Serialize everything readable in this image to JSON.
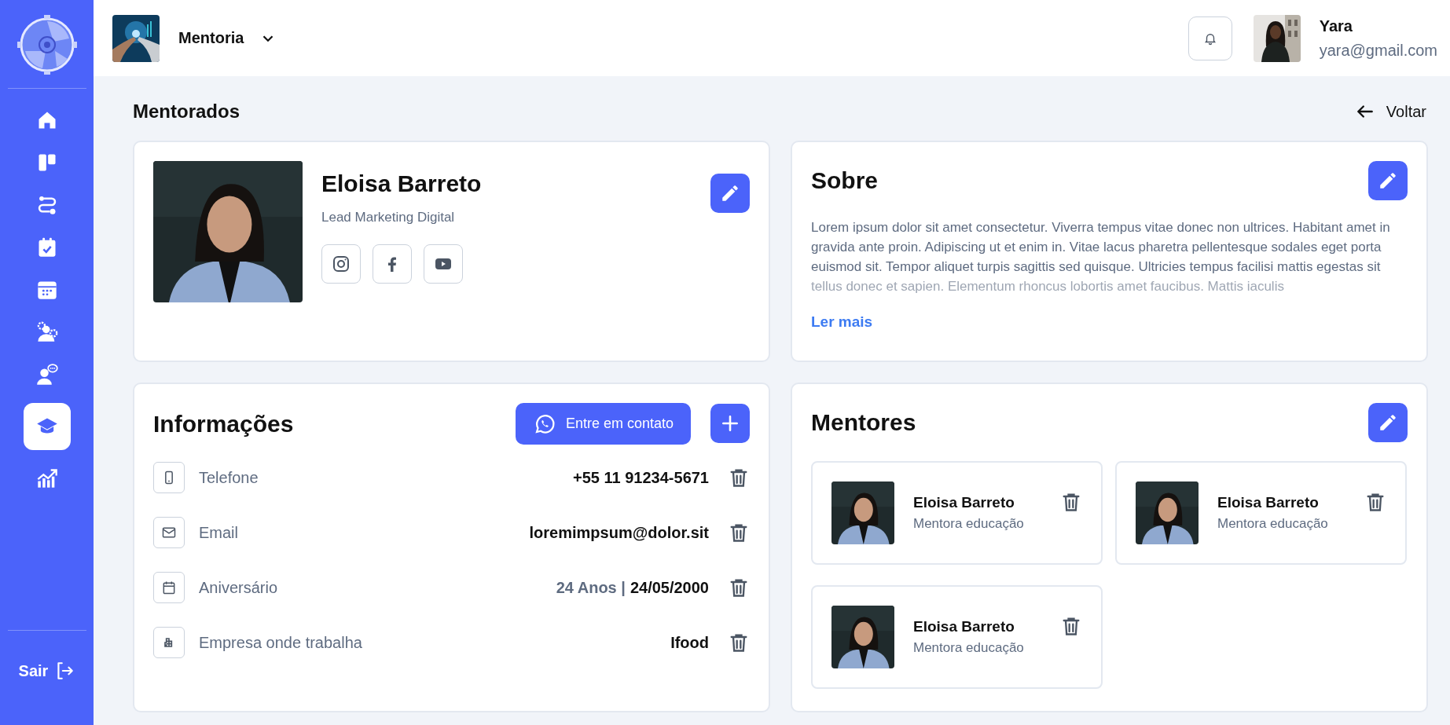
{
  "sidebar": {
    "items": [
      {
        "kind": "home",
        "selected": false
      },
      {
        "kind": "board",
        "selected": false
      },
      {
        "kind": "route",
        "selected": false
      },
      {
        "kind": "task",
        "selected": false
      },
      {
        "kind": "calendar",
        "selected": false
      },
      {
        "kind": "team",
        "selected": false
      },
      {
        "kind": "chat",
        "selected": false
      },
      {
        "kind": "course",
        "selected": true
      },
      {
        "kind": "chart",
        "selected": false
      }
    ],
    "logout": "Sair"
  },
  "header": {
    "program": "Mentoria",
    "user": {
      "name": "Yara",
      "email": "yara@gmail.com"
    }
  },
  "page": {
    "title": "Mentorados",
    "back": "Voltar"
  },
  "profile": {
    "name": "Eloisa Barreto",
    "role": "Lead Marketing Digital",
    "socials": [
      {
        "kind": "instagram"
      },
      {
        "kind": "facebook"
      },
      {
        "kind": "youtube"
      }
    ]
  },
  "about": {
    "title": "Sobre",
    "text": "Lorem ipsum dolor sit amet consectetur. Viverra tempus vitae donec non ultrices. Habitant amet in gravida ante proin. Adipiscing ut et enim in. Vitae lacus pharetra pellentesque sodales eget porta euismod sit. Tempor aliquet turpis sagittis sed quisque. Ultricies tempus facilisi mattis egestas sit tellus donec et sapien. Elementum rhoncus lobortis amet faucibus. Mattis iaculis",
    "more": "Ler mais"
  },
  "info": {
    "title": "Informações",
    "contact": "Entre em contato",
    "rows": [
      {
        "kind": "phone",
        "label": "Telefone",
        "value": "+55 11 91234-5671"
      },
      {
        "kind": "email",
        "label": "Email",
        "value": "loremimpsum@dolor.sit"
      },
      {
        "kind": "calendar",
        "label": "Aniversário",
        "muted": "24 Anos |",
        "value": "24/05/2000"
      },
      {
        "kind": "building",
        "label": "Empresa onde trabalha",
        "value": "Ifood"
      }
    ]
  },
  "mentors": {
    "title": "Mentores",
    "items": [
      {
        "name": "Eloisa Barreto",
        "role": "Mentora educação"
      },
      {
        "name": "Eloisa Barreto",
        "role": "Mentora educação"
      },
      {
        "name": "Eloisa Barreto",
        "role": "Mentora educação"
      }
    ]
  }
}
